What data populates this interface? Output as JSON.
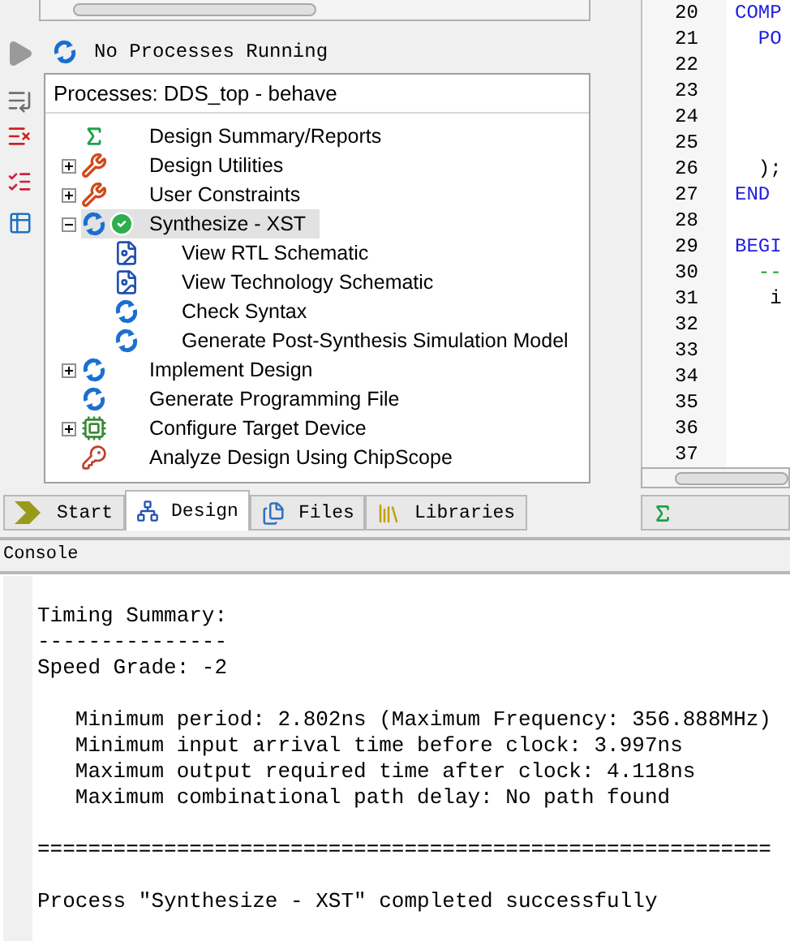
{
  "status": {
    "text": "No Processes Running"
  },
  "processes": {
    "title": "Processes: DDS_top - behave",
    "items": [
      {
        "label": "Design Summary/Reports",
        "kind": "summary",
        "selected": false,
        "completed": false
      },
      {
        "label": "Design Utilities",
        "kind": "tools",
        "selected": false,
        "completed": false,
        "expanded": false
      },
      {
        "label": "User Constraints",
        "kind": "tools",
        "selected": false,
        "completed": false,
        "expanded": false
      },
      {
        "label": "Synthesize - XST",
        "kind": "process",
        "selected": true,
        "completed": true,
        "expanded": true,
        "children": [
          {
            "label": "View RTL Schematic",
            "kind": "schematic",
            "selected": false,
            "completed": false
          },
          {
            "label": "View Technology Schematic",
            "kind": "schematic",
            "selected": false,
            "completed": false
          },
          {
            "label": "Check Syntax",
            "kind": "process",
            "selected": false,
            "completed": false
          },
          {
            "label": "Generate Post-Synthesis Simulation Model",
            "kind": "process",
            "selected": false,
            "completed": false
          }
        ]
      },
      {
        "label": "Implement Design",
        "kind": "process",
        "selected": false,
        "completed": false,
        "expanded": false
      },
      {
        "label": "Generate Programming File",
        "kind": "process",
        "selected": false,
        "completed": false
      },
      {
        "label": "Configure Target Device",
        "kind": "device",
        "selected": false,
        "completed": false,
        "expanded": false
      },
      {
        "label": "Analyze Design Using ChipScope",
        "kind": "analyzer",
        "selected": false,
        "completed": false
      }
    ]
  },
  "tabs": [
    {
      "label": "Start",
      "kind": "start",
      "selected": false
    },
    {
      "label": "Design",
      "kind": "design",
      "selected": true
    },
    {
      "label": "Files",
      "kind": "files",
      "selected": false
    },
    {
      "label": "Libraries",
      "kind": "libraries",
      "selected": false
    }
  ],
  "editor": {
    "lines": [
      {
        "number": "20",
        "text": "COMP",
        "kind": "keyword"
      },
      {
        "number": "21",
        "text": "  PO",
        "kind": "keyword"
      },
      {
        "number": "22"
      },
      {
        "number": "23"
      },
      {
        "number": "24"
      },
      {
        "number": "25"
      },
      {
        "number": "26",
        "text": "  );",
        "kind": "plain"
      },
      {
        "number": "27",
        "text": "END",
        "kind": "keyword"
      },
      {
        "number": "28"
      },
      {
        "number": "29",
        "text": "BEGI",
        "kind": "keyword"
      },
      {
        "number": "30",
        "text": "  --",
        "kind": "comment"
      },
      {
        "number": "31",
        "text": "   i",
        "kind": "plain"
      },
      {
        "number": "32"
      },
      {
        "number": "33"
      },
      {
        "number": "34"
      },
      {
        "number": "35"
      },
      {
        "number": "36"
      },
      {
        "number": "37"
      }
    ]
  },
  "console": {
    "title": "Console",
    "sections": [
      [
        "Timing Summary:",
        "---------------",
        "Speed Grade: -2"
      ],
      [
        "   Minimum period: 2.802ns (Maximum Frequency: 356.888MHz)",
        "   Minimum input arrival time before clock: 3.997ns",
        "   Maximum output required time after clock: 4.118ns",
        "   Maximum combinational path delay: No path found"
      ],
      [
        "=========================================================="
      ],
      [
        "Process \"Synthesize - XST\" completed successfully"
      ]
    ]
  }
}
